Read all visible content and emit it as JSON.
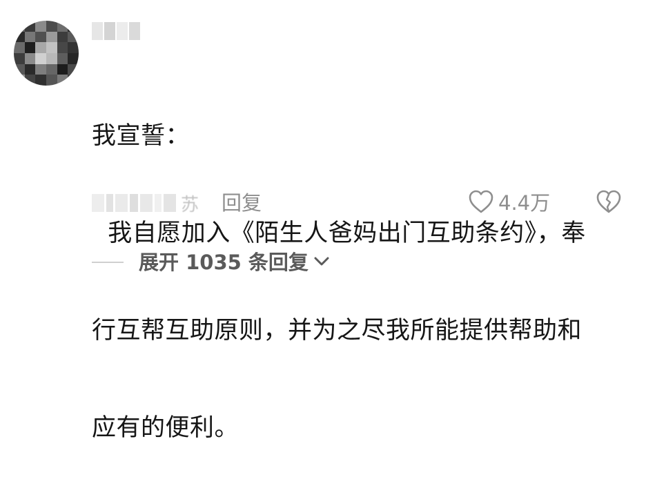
{
  "comment": {
    "avatar_alt": "avatar",
    "lines": [
      "我宣誓：",
      "  我自愿加入《陌生人爸妈出门互助条约》，奉",
      "行互帮互助原则，并为之尽我所能提供帮助和",
      "应有的便利。"
    ],
    "location_tail": "苏",
    "reply_label": "回复",
    "like_count": "4.4万"
  },
  "replies": {
    "expand_label": "展开 1035 条回复"
  },
  "icons": {
    "like": "heart-outline-icon",
    "dislike": "broken-heart-icon",
    "expand": "chevron-down-icon"
  },
  "colors": {
    "text": "#161616",
    "muted": "#8e8e8e",
    "expand_text": "#5a5a5a"
  }
}
